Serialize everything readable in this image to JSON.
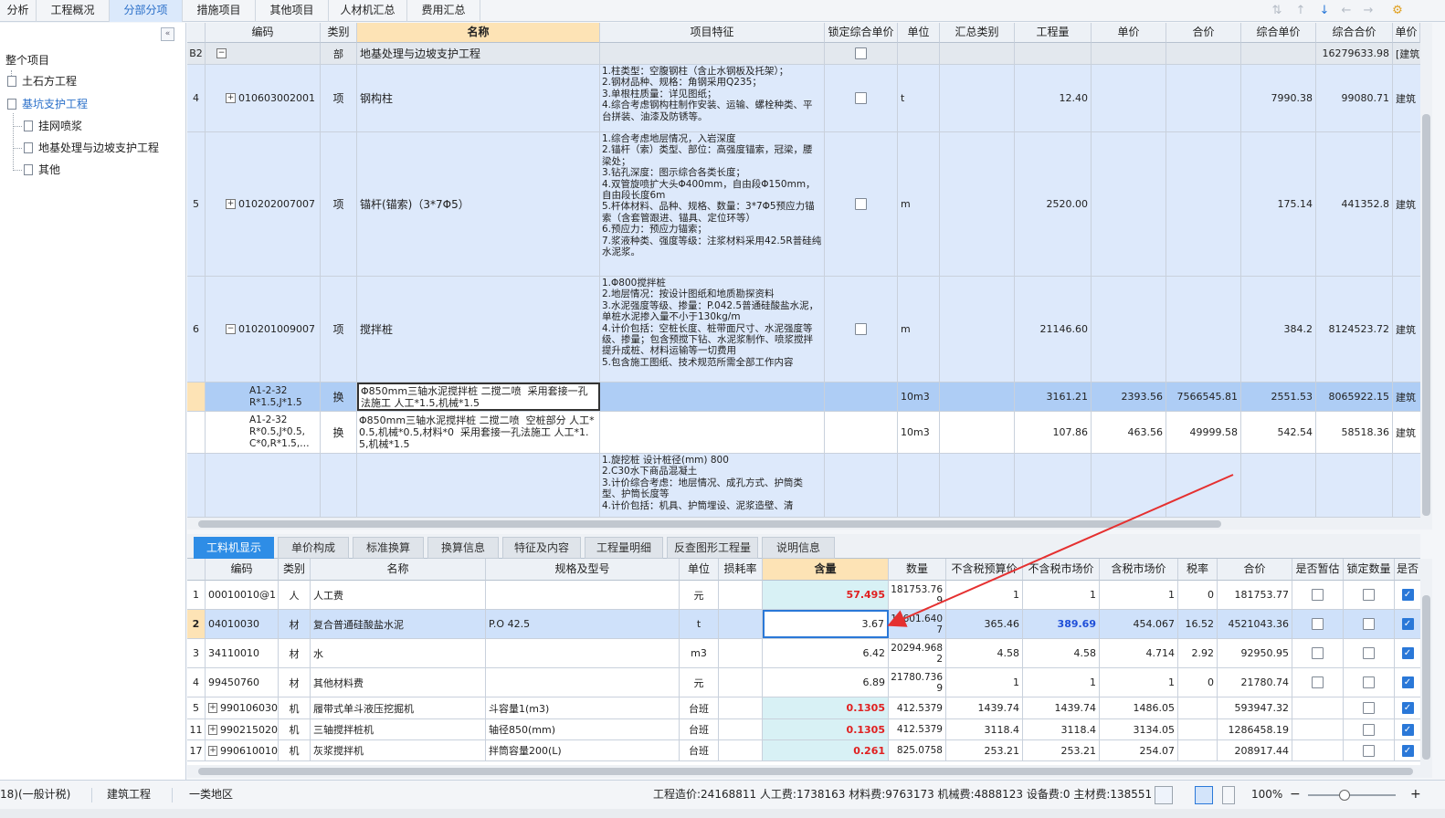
{
  "top_tabs": [
    "分析",
    "工程概况",
    "分部分项",
    "措施项目",
    "其他项目",
    "人材机汇总",
    "费用汇总"
  ],
  "active_top_tab": "分部分项",
  "tree": {
    "root": "整个项目",
    "items": [
      "土石方工程",
      "基坑支护工程",
      "挂网喷浆",
      "地基处理与边坡支护工程",
      "其他"
    ],
    "selected": "基坑支护工程"
  },
  "upper_grid": {
    "headers": [
      "编码",
      "类别",
      "名称",
      "项目特征",
      "锁定综合单价",
      "单位",
      "汇总类别",
      "工程量",
      "单价",
      "合价",
      "综合单价",
      "综合合价",
      "单价"
    ],
    "rows": [
      {
        "num": "B2",
        "code": "",
        "type": "部",
        "name": "地基处理与边坡支护工程",
        "feature": "",
        "unit": "",
        "qty": "",
        "price": "",
        "total": "",
        "comp_price": "",
        "comp_total": "16279633.98",
        "extra": "[建筑"
      },
      {
        "num": "4",
        "code": "010603002001",
        "type": "项",
        "name": "钢构柱",
        "feature": "1.柱类型：空腹钢柱（含止水钢板及托架）；\n2.钢材品种、规格：角钢采用Q235；\n3.单根柱质量：详见图纸；\n4.综合考虑钢构柱制作安装、运输、螺栓种类、平台拼装、油漆及防锈等。",
        "unit": "t",
        "qty": "12.40",
        "price": "",
        "total": "",
        "comp_price": "7990.38",
        "comp_total": "99080.71",
        "extra": "建筑"
      },
      {
        "num": "5",
        "code": "010202007007",
        "type": "项",
        "name": "锚杆(锚索)（3*7Φ5）",
        "feature": "1.综合考虑地层情况，入岩深度\n2.锚杆（索）类型、部位：高强度锚索，冠梁，腰梁处；\n3.钻孔深度：图示综合各类长度；\n4.双管旋喷扩大头Φ400mm，自由段Φ150mm，自由段长度6m\n5.杆体材料、品种、规格、数量：3*7Φ5预应力锚索（含套管跟进、锚具、定位环等）\n6.预应力：预应力锚索；\n7.浆液种类、强度等级：注浆材料采用42.5R普硅纯水泥浆。",
        "unit": "m",
        "qty": "2520.00",
        "price": "",
        "total": "",
        "comp_price": "175.14",
        "comp_total": "441352.8",
        "extra": "建筑"
      },
      {
        "num": "6",
        "code": "010201009007",
        "type": "项",
        "name": "搅拌桩",
        "feature": "1.Φ800搅拌桩\n2.地层情况：按设计图纸和地质勘探资料\n3.水泥强度等级、掺量：P.042.5普通硅酸盐水泥，单桩水泥掺入量不小于130kg/m\n4.计价包括：空桩长度、桩带面尺寸、水泥强度等级、掺量；包含预搅下钻、水泥浆制作、喷浆搅拌提升成桩、材料运输等一切费用\n5.包含施工图纸、技术规范所需全部工作内容",
        "unit": "m",
        "qty": "21146.60",
        "price": "",
        "total": "",
        "comp_price": "384.2",
        "comp_total": "8124523.72",
        "extra": "建筑"
      },
      {
        "num": "",
        "code": "A1-2-32\nR*1.5,J*1.5",
        "type": "换",
        "name": "Φ850mm三轴水泥搅拌桩 二搅二喷  采用套接一孔法施工 人工*1.5,机械*1.5",
        "feature": "",
        "unit": "10m3",
        "qty": "3161.21",
        "price": "2393.56",
        "total": "7566545.81",
        "comp_price": "2551.53",
        "comp_total": "8065922.15",
        "extra": "建筑"
      },
      {
        "num": "",
        "code": "A1-2-32\nR*0.5,J*0.5,\nC*0,R*1.5,…",
        "type": "换",
        "name": "Φ850mm三轴水泥搅拌桩 二搅二喷  空桩部分 人工*0.5,机械*0.5,材料*0  采用套接一孔法施工 人工*1.5,机械*1.5",
        "feature": "",
        "unit": "10m3",
        "qty": "107.86",
        "price": "463.56",
        "total": "49999.58",
        "comp_price": "542.54",
        "comp_total": "58518.36",
        "extra": "建筑"
      },
      {
        "num": "",
        "code": "",
        "type": "",
        "name": "",
        "feature": "1.旋挖桩 设计桩径(mm) 800\n2.C30水下商品混凝土\n3.计价综合考虑：地层情况、成孔方式、护筒类型、护筒长度等\n4.计价包括：机具、护筒埋设、泥浆造壁、清",
        "unit": "",
        "qty": "",
        "price": "",
        "total": "",
        "comp_price": "",
        "comp_total": "",
        "extra": ""
      }
    ]
  },
  "lower_tabs": [
    "工料机显示",
    "单价构成",
    "标准换算",
    "换算信息",
    "特征及内容",
    "工程量明细",
    "反查图形工程量",
    "说明信息"
  ],
  "active_lower_tab": "工料机显示",
  "lower_grid": {
    "headers": [
      "编码",
      "类别",
      "名称",
      "规格及型号",
      "单位",
      "损耗率",
      "含量",
      "数量",
      "不含税预算价",
      "不含税市场价",
      "含税市场价",
      "税率",
      "合价",
      "是否暂估",
      "锁定数量",
      "是否计价"
    ],
    "rows": [
      {
        "num": "1",
        "code": "00010010@1",
        "type": "人",
        "name": "人工费",
        "spec": "",
        "unit": "元",
        "loss": "",
        "content": "57.495",
        "qty": "181753.76\n9",
        "budget": "1",
        "market": "1",
        "tax_market": "1",
        "tax_rate": "0",
        "total": "181753.77",
        "est": false,
        "lock": false,
        "priced": true
      },
      {
        "num": "2",
        "code": "04010030",
        "type": "材",
        "name": "复合普通硅酸盐水泥",
        "spec": "P.O 42.5",
        "unit": "t",
        "loss": "",
        "content": "3.67",
        "qty": "11601.640\n7",
        "budget": "365.46",
        "market": "389.69",
        "tax_market": "454.067",
        "tax_rate": "16.52",
        "total": "4521043.36",
        "est": false,
        "lock": false,
        "priced": true
      },
      {
        "num": "3",
        "code": "34110010",
        "type": "材",
        "name": "水",
        "spec": "",
        "unit": "m3",
        "loss": "",
        "content": "6.42",
        "qty": "20294.968\n2",
        "budget": "4.58",
        "market": "4.58",
        "tax_market": "4.714",
        "tax_rate": "2.92",
        "total": "92950.95",
        "est": false,
        "lock": false,
        "priced": true
      },
      {
        "num": "4",
        "code": "99450760",
        "type": "材",
        "name": "其他材料费",
        "spec": "",
        "unit": "元",
        "loss": "",
        "content": "6.89",
        "qty": "21780.736\n9",
        "budget": "1",
        "market": "1",
        "tax_market": "1",
        "tax_rate": "0",
        "total": "21780.74",
        "est": false,
        "lock": false,
        "priced": true
      },
      {
        "num": "5",
        "code": "990106030",
        "type": "机",
        "name": "履带式单斗液压挖掘机",
        "spec": "斗容量1(m3)",
        "unit": "台班",
        "loss": "",
        "content": "0.1305",
        "qty": "412.5379",
        "budget": "1439.74",
        "market": "1439.74",
        "tax_market": "1486.05",
        "tax_rate": "",
        "total": "593947.32",
        "est": null,
        "lock": false,
        "priced": true
      },
      {
        "num": "11",
        "code": "990215020",
        "type": "机",
        "name": "三轴搅拌桩机",
        "spec": "轴径850(mm)",
        "unit": "台班",
        "loss": "",
        "content": "0.1305",
        "qty": "412.5379",
        "budget": "3118.4",
        "market": "3118.4",
        "tax_market": "3134.05",
        "tax_rate": "",
        "total": "1286458.19",
        "est": null,
        "lock": false,
        "priced": true
      },
      {
        "num": "17",
        "code": "990610010",
        "type": "机",
        "name": "灰浆搅拌机",
        "spec": "拌筒容量200(L)",
        "unit": "台班",
        "loss": "",
        "content": "0.261",
        "qty": "825.0758",
        "budget": "253.21",
        "market": "253.21",
        "tax_market": "254.07",
        "tax_rate": "",
        "total": "208917.44",
        "est": null,
        "lock": false,
        "priced": true
      }
    ]
  },
  "status": {
    "tax_mode": "18)(一般计税)",
    "project_type": "建筑工程",
    "region": "一类地区",
    "summary": "工程造价:24168811  人工费:1738163  材料费:9763173  机械费:4888123  设备费:0  主材费:138551",
    "zoom": "100%"
  },
  "colors": {
    "accent": "#2e8de6",
    "highlight_red": "#e02020",
    "arrow": "#e53030"
  }
}
